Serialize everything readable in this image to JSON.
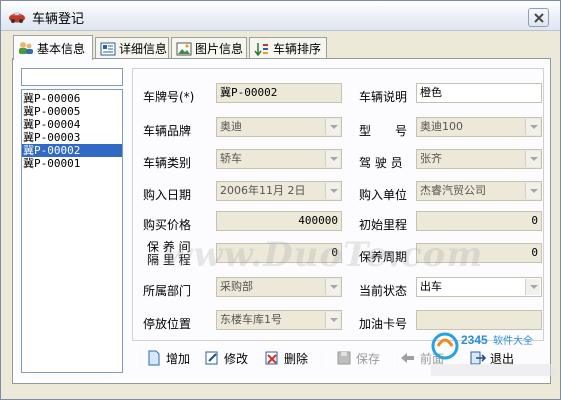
{
  "window": {
    "title": "车辆登记",
    "close_symbol": "x"
  },
  "tabs": [
    {
      "label": "基本信息",
      "icon": "people-icon",
      "active": true
    },
    {
      "label": "详细信息",
      "icon": "details-icon",
      "active": false
    },
    {
      "label": "图片信息",
      "icon": "picture-icon",
      "active": false
    },
    {
      "label": "车辆排序",
      "icon": "sort-icon",
      "active": false
    }
  ],
  "search": {
    "value": ""
  },
  "vehicle_list": {
    "items": [
      "冀P-00006",
      "冀P-00005",
      "冀P-00004",
      "冀P-00003",
      "冀P-00002",
      "冀P-00001"
    ],
    "selected_index": 4
  },
  "form": {
    "plate": {
      "label": "车牌号(*)",
      "value": "冀P-00002"
    },
    "description": {
      "label": "车辆说明",
      "value": "橙色"
    },
    "brand": {
      "label": "车辆品牌",
      "value": "奥迪"
    },
    "model": {
      "label": "型　　号",
      "value": "奥迪100"
    },
    "category": {
      "label": "车辆类别",
      "value": "轿车"
    },
    "driver": {
      "label": "驾 驶 员",
      "value": "张齐"
    },
    "purchase_date": {
      "label": "购入日期",
      "value": "2006年11月 2日"
    },
    "purchase_unit": {
      "label": "购入单位",
      "value": "杰睿汽贸公司"
    },
    "price": {
      "label": "购买价格",
      "value": "400000"
    },
    "initial_mileage": {
      "label": "初始里程",
      "value": "0"
    },
    "maint_interval_mileage": {
      "label_line1": "保 养 间",
      "label_line2": "隔 里 程",
      "value": "0"
    },
    "maint_period": {
      "label": "保养周期",
      "value": "0"
    },
    "department": {
      "label": "所属部门",
      "value": "采购部"
    },
    "status": {
      "label": "当前状态",
      "value": "出车"
    },
    "parking": {
      "label": "停放位置",
      "value": "东楼车库1号"
    },
    "fuel_card": {
      "label": "加油卡号",
      "value": ""
    }
  },
  "toolbar": {
    "add": "增加",
    "edit": "修改",
    "delete": "删除",
    "save": "保存",
    "prev": "前面",
    "exit": "退出"
  },
  "watermark": "www.DuoTe.com",
  "brand_logo_text": "2345软件大全",
  "colors": {
    "selection": "#316ac5",
    "window_bg": "#ece9d8",
    "panel_bg": "#fcfcfe"
  }
}
